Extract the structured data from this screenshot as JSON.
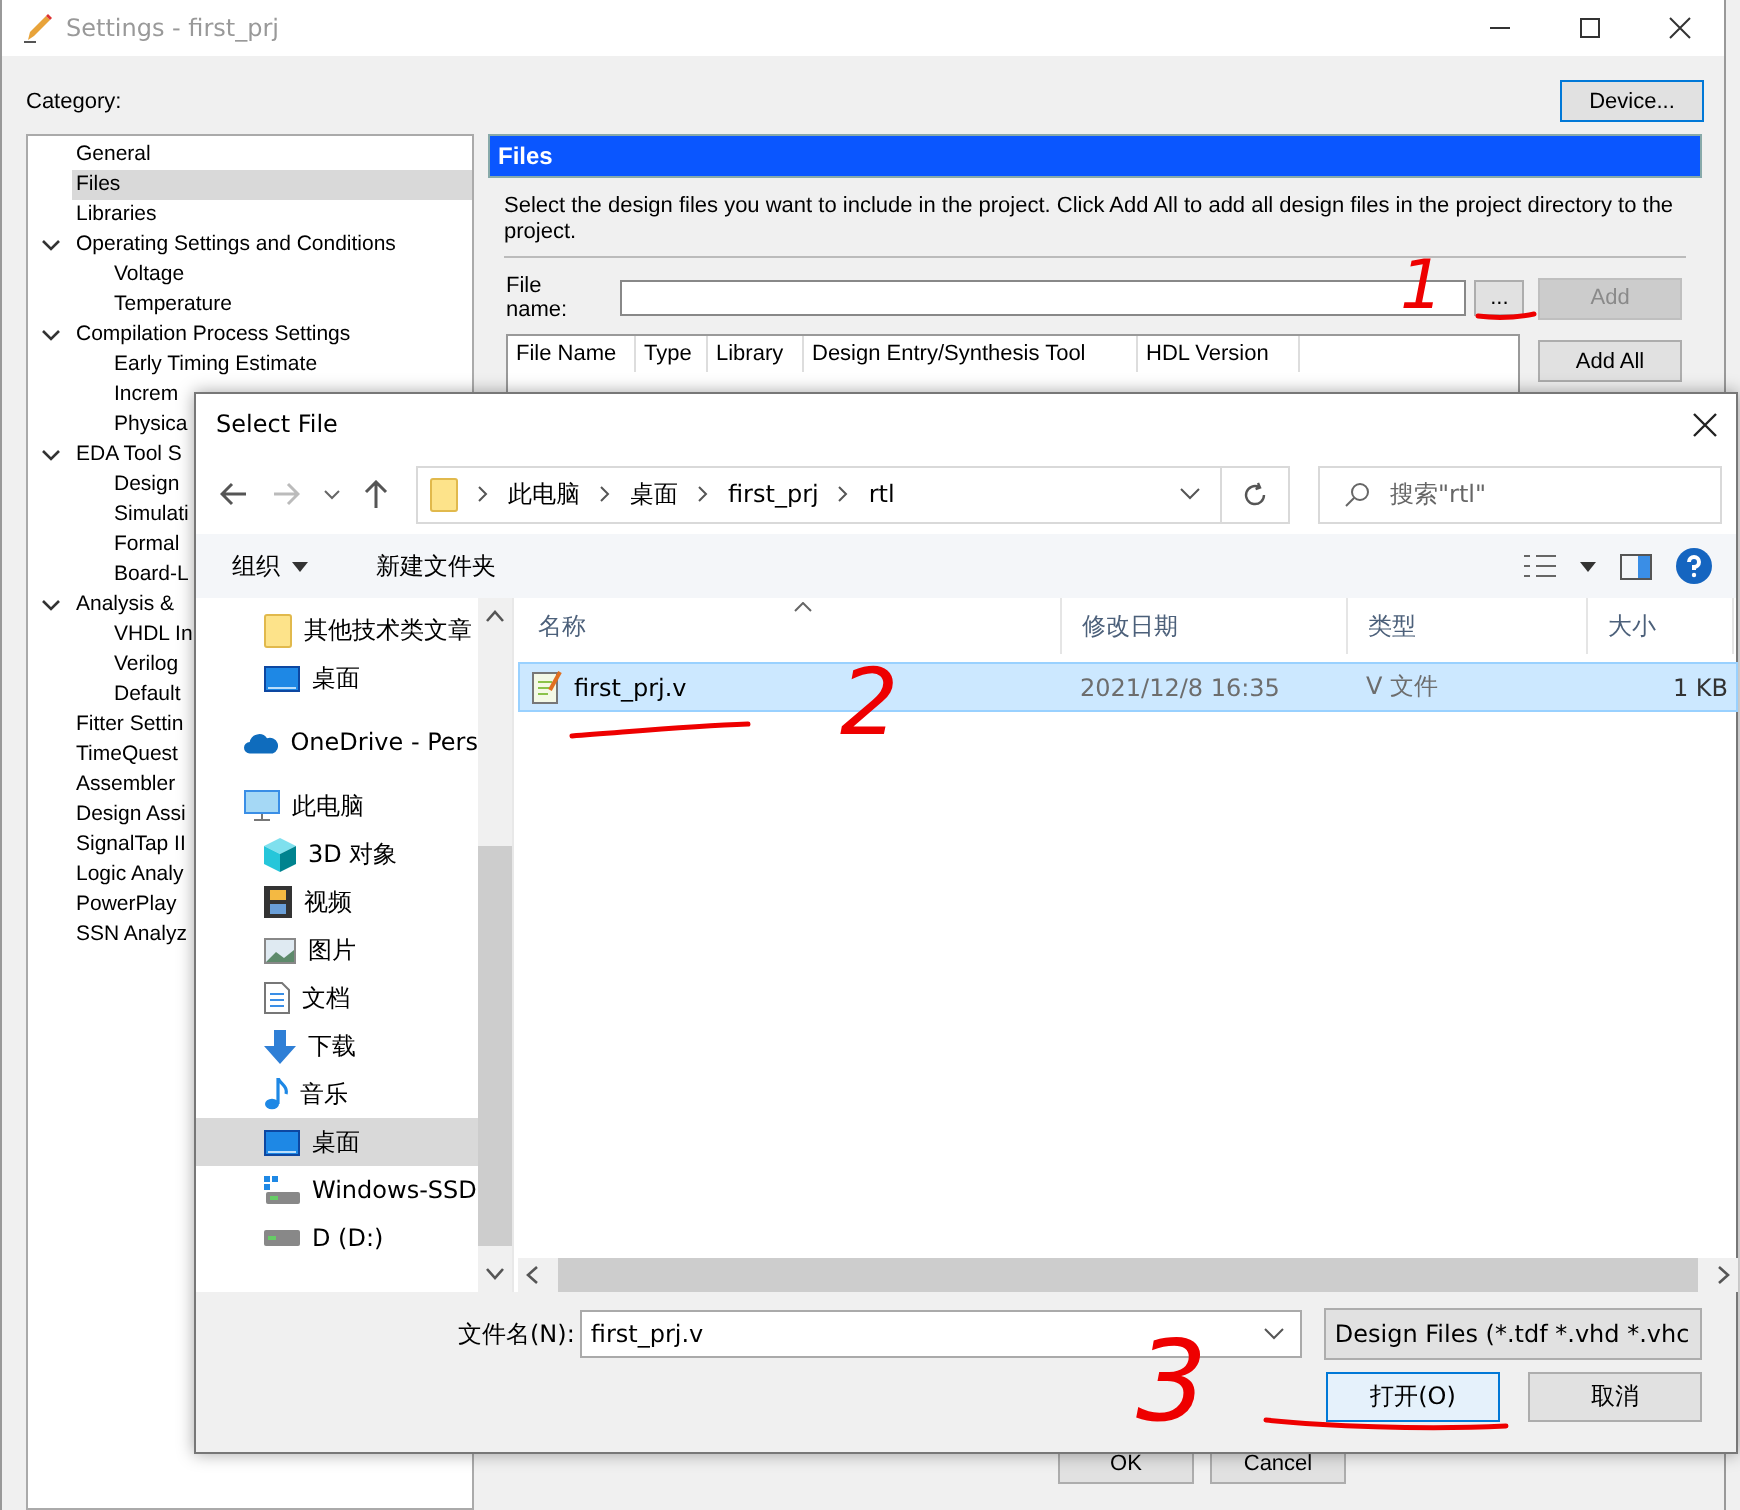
{
  "window": {
    "title": "Settings - first_prj"
  },
  "category_label": "Category:",
  "device_button": "Device...",
  "tree": [
    {
      "label": "General",
      "selected": false
    },
    {
      "label": "Files",
      "selected": true
    },
    {
      "label": "Libraries",
      "selected": false
    },
    {
      "label": "Operating Settings and Conditions",
      "selected": false,
      "expanded": true,
      "children": [
        {
          "label": "Voltage",
          "selected": false
        },
        {
          "label": "Temperature",
          "selected": false
        }
      ]
    },
    {
      "label": "Compilation Process Settings",
      "selected": false,
      "expanded": true,
      "children": [
        {
          "label": "Early Timing Estimate",
          "selected": false
        },
        {
          "label": "Increm",
          "selected": false
        },
        {
          "label": "Physica",
          "selected": false
        }
      ]
    },
    {
      "label": "EDA Tool S",
      "selected": false,
      "expanded": true,
      "children": [
        {
          "label": "Design",
          "selected": false
        },
        {
          "label": "Simulati",
          "selected": false
        },
        {
          "label": "Formal",
          "selected": false
        },
        {
          "label": "Board-L",
          "selected": false
        }
      ]
    },
    {
      "label": "Analysis &",
      "selected": false,
      "expanded": true,
      "children": [
        {
          "label": "VHDL In",
          "selected": false
        },
        {
          "label": "Verilog",
          "selected": false
        },
        {
          "label": "Default",
          "selected": false
        }
      ]
    },
    {
      "label": "Fitter Settin",
      "selected": false
    },
    {
      "label": "TimeQuest",
      "selected": false
    },
    {
      "label": "Assembler",
      "selected": false
    },
    {
      "label": "Design Assi",
      "selected": false
    },
    {
      "label": "SignalTap II",
      "selected": false
    },
    {
      "label": "Logic Analy",
      "selected": false
    },
    {
      "label": "PowerPlay",
      "selected": false
    },
    {
      "label": "SSN Analyz",
      "selected": false
    }
  ],
  "files_panel": {
    "title": "Files",
    "description": "Select the design files you want to include in the project. Click Add All to add all design files in the project directory to the project.",
    "file_name_label": "File name:",
    "browse_button": "...",
    "add_button": {
      "label": "Add",
      "disabled": true
    },
    "add_all_button": "Add All",
    "columns": [
      "File Name",
      "Type",
      "Library",
      "Design Entry/Synthesis Tool",
      "HDL Version"
    ]
  },
  "footer_buttons": [
    "OK",
    "Cancel"
  ],
  "dialog": {
    "title": "Select File",
    "path": [
      "此电脑",
      "桌面",
      "first_prj",
      "rtl"
    ],
    "search_placeholder": "搜索\"rtl\"",
    "toolbar": [
      {
        "label": "组织",
        "menu": true
      },
      {
        "label": "新建文件夹",
        "menu": false
      }
    ],
    "nav": [
      {
        "children": [
          {
            "kind": "folder",
            "label": "其他技术类文章",
            "selected": false
          },
          {
            "kind": "desktop",
            "label": "桌面",
            "selected": false
          }
        ]
      },
      {
        "kind": "cloud",
        "label": "OneDrive - Pers",
        "selected": false
      },
      {
        "kind": "computer",
        "label": "此电脑",
        "selected": false,
        "children": [
          {
            "kind": "cube",
            "label": "3D 对象",
            "selected": false
          },
          {
            "kind": "film",
            "label": "视频",
            "selected": false
          },
          {
            "kind": "image",
            "label": "图片",
            "selected": false
          },
          {
            "kind": "document",
            "label": "文档",
            "selected": false
          },
          {
            "kind": "download",
            "label": "下载",
            "selected": false
          },
          {
            "kind": "music",
            "label": "音乐",
            "selected": false
          },
          {
            "kind": "desktop",
            "label": "桌面",
            "selected": true
          },
          {
            "kind": "windrive",
            "label": "Windows-SSD",
            "selected": false
          },
          {
            "kind": "drive",
            "label": "D (D:)",
            "selected": false
          }
        ]
      }
    ],
    "columns": [
      "名称",
      "修改日期",
      "类型",
      "大小"
    ],
    "files": [
      {
        "name": "first_prj.v",
        "date": "2021/12/8 16:35",
        "type": "V 文件",
        "size": "1 KB",
        "selected": true
      }
    ],
    "file_name_label": "文件名(N):",
    "file_name": "first_prj.v",
    "filter": "Design Files (*.tdf *.vhd *.vhc",
    "open_button": "打开(O)",
    "cancel_button": "取消"
  },
  "annotations": [
    {
      "text": "1"
    },
    {
      "text": "2"
    },
    {
      "text": "3"
    }
  ]
}
